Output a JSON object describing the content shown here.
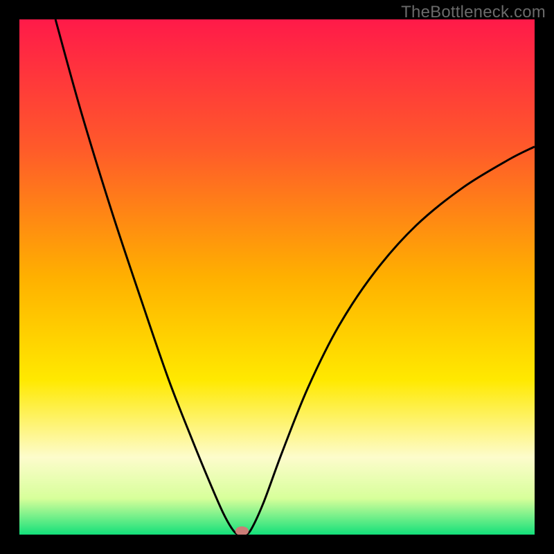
{
  "watermark": "TheBottleneck.com",
  "chart_data": {
    "type": "line",
    "title": "",
    "xlabel": "",
    "ylabel": "",
    "xlim": [
      0,
      100
    ],
    "ylim": [
      0,
      100
    ],
    "background_gradient": {
      "stops": [
        {
          "offset": 0,
          "color": "#ff1a49"
        },
        {
          "offset": 25,
          "color": "#ff5a2a"
        },
        {
          "offset": 50,
          "color": "#ffb000"
        },
        {
          "offset": 70,
          "color": "#ffe900"
        },
        {
          "offset": 85,
          "color": "#fdfccc"
        },
        {
          "offset": 93,
          "color": "#d7ff9a"
        },
        {
          "offset": 100,
          "color": "#13e07a"
        }
      ]
    },
    "series": [
      {
        "name": "bottleneck-curve",
        "color": "#000000",
        "points": [
          {
            "x": 7.0,
            "y": 100.0
          },
          {
            "x": 12.0,
            "y": 82.0
          },
          {
            "x": 18.0,
            "y": 62.5
          },
          {
            "x": 24.0,
            "y": 44.5
          },
          {
            "x": 29.0,
            "y": 30.0
          },
          {
            "x": 33.5,
            "y": 18.5
          },
          {
            "x": 37.0,
            "y": 10.0
          },
          {
            "x": 39.5,
            "y": 4.3
          },
          {
            "x": 41.3,
            "y": 1.1
          },
          {
            "x": 42.5,
            "y": 0.0
          },
          {
            "x": 44.0,
            "y": 0.0
          },
          {
            "x": 45.2,
            "y": 1.4
          },
          {
            "x": 47.5,
            "y": 6.5
          },
          {
            "x": 51.0,
            "y": 16.0
          },
          {
            "x": 56.0,
            "y": 28.5
          },
          {
            "x": 62.0,
            "y": 40.5
          },
          {
            "x": 69.0,
            "y": 51.0
          },
          {
            "x": 77.0,
            "y": 60.0
          },
          {
            "x": 86.0,
            "y": 67.3
          },
          {
            "x": 95.0,
            "y": 72.8
          },
          {
            "x": 100.0,
            "y": 75.3
          }
        ]
      }
    ],
    "marker": {
      "x": 43.2,
      "y": 0.7,
      "rx": 1.3,
      "ry": 0.9,
      "color": "#cb7d77"
    }
  }
}
